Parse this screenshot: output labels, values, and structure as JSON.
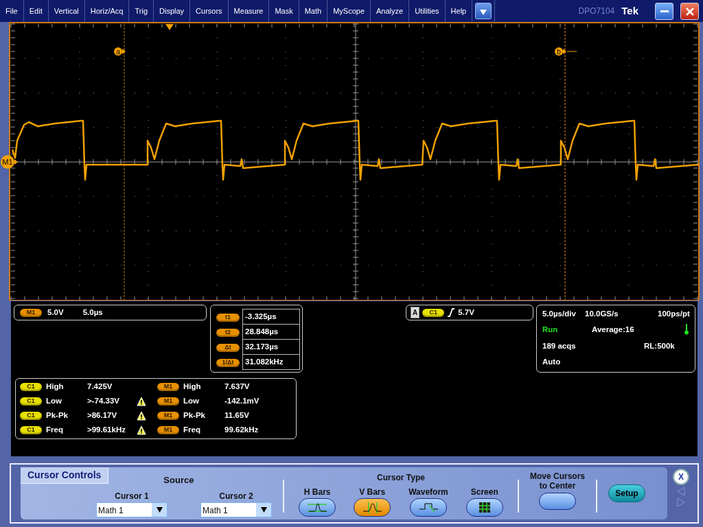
{
  "menu": [
    "File",
    "Edit",
    "Vertical",
    "Horiz/Acq",
    "Trig",
    "Display",
    "Cursors",
    "Measure",
    "Mask",
    "Math",
    "MyScope",
    "Analyze",
    "Utilities",
    "Help"
  ],
  "title": {
    "model": "DPO7104",
    "brand": "Tek"
  },
  "scope": {
    "reference_marker": "M1",
    "cursor_a": "a",
    "cursor_b": "b"
  },
  "channel_readout": {
    "badge": "M1",
    "scale": "5.0V",
    "timebase": "5.0µs"
  },
  "cursor_readouts": [
    {
      "label": "t1",
      "value": "-3.325µs"
    },
    {
      "label": "t2",
      "value": "28.848µs"
    },
    {
      "label": "Δt",
      "value": "32.173µs"
    },
    {
      "label": "1/Δt",
      "value": "31.082kHz"
    }
  ],
  "trigger": {
    "mode": "A",
    "source": "C1",
    "level": "5.7V"
  },
  "acquisition": {
    "time_per_div": "5.0µs/div",
    "sample_rate": "10.0GS/s",
    "resolution": "100ps/pt",
    "state": "Run",
    "average": "Average:16",
    "acqs": "189 acqs",
    "record_length": "RL:500k",
    "mode": "Auto"
  },
  "measurements": [
    {
      "color": "#e8e000",
      "rows": [
        {
          "source": "C1",
          "name": "High",
          "value": "7.425V",
          "warning": false
        },
        {
          "source": "C1",
          "name": "Low",
          "value": ">-74.33V",
          "warning": true
        },
        {
          "source": "C1",
          "name": "Pk-Pk",
          "value": ">86.17V",
          "warning": true
        },
        {
          "source": "C1",
          "name": "Freq",
          "value": ">99.61kHz",
          "warning": true
        }
      ]
    },
    {
      "color": "#e89000",
      "rows": [
        {
          "source": "M1",
          "name": "High",
          "value": "7.637V",
          "warning": false
        },
        {
          "source": "M1",
          "name": "Low",
          "value": "-142.1mV",
          "warning": false
        },
        {
          "source": "M1",
          "name": "Pk-Pk",
          "value": "11.65V",
          "warning": false
        },
        {
          "source": "M1",
          "name": "Freq",
          "value": "99.62kHz",
          "warning": false
        }
      ]
    }
  ],
  "cursor_controls": {
    "tab": "Cursor Controls",
    "source_title": "Source",
    "sources": [
      {
        "label": "Cursor 1",
        "value": "Math 1"
      },
      {
        "label": "Cursor 2",
        "value": "Math 1"
      }
    ],
    "type_title": "Cursor Type",
    "types": [
      {
        "kind": "hbars",
        "label": "H Bars",
        "selected": false
      },
      {
        "kind": "vbars",
        "label": "V Bars",
        "selected": true
      },
      {
        "kind": "waveform",
        "label": "Waveform",
        "selected": false
      },
      {
        "kind": "screen",
        "label": "Screen",
        "selected": false
      }
    ],
    "center_label": "Move Cursors to Center",
    "setup": "Setup",
    "close": "X"
  }
}
